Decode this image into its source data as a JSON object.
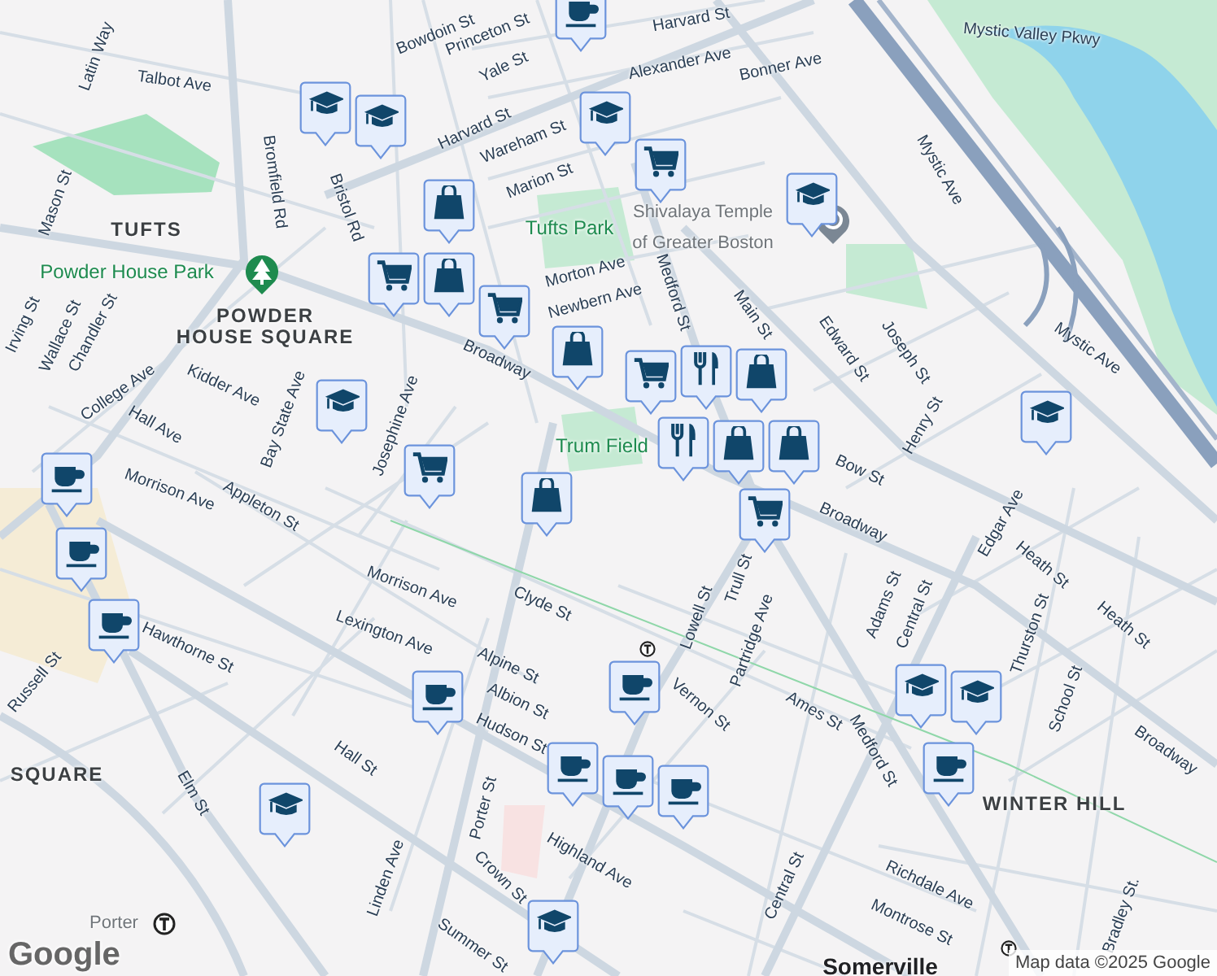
{
  "map": {
    "labels": [
      {
        "text": "Bowdoin St",
        "kind": "street"
      },
      {
        "text": "Princeton St",
        "kind": "street"
      },
      {
        "text": "Yale St",
        "kind": "street"
      },
      {
        "text": "Harvard St",
        "kind": "street"
      },
      {
        "text": "Harvard St",
        "kind": "street"
      },
      {
        "text": "Alexander Ave",
        "kind": "street"
      },
      {
        "text": "Bonner Ave",
        "kind": "street"
      },
      {
        "text": "Wareham St",
        "kind": "street"
      },
      {
        "text": "Marion St",
        "kind": "street"
      },
      {
        "text": "Talbot Ave",
        "kind": "street"
      },
      {
        "text": "Latin Way",
        "kind": "street"
      },
      {
        "text": "Mason St",
        "kind": "street"
      },
      {
        "text": "Bromfield Rd",
        "kind": "street"
      },
      {
        "text": "TUFTS",
        "kind": "district"
      },
      {
        "text": "Powder House Park",
        "kind": "park"
      },
      {
        "text": "POWDER",
        "kind": "district"
      },
      {
        "text": "HOUSE SQUARE",
        "kind": "district"
      },
      {
        "text": "Irving St",
        "kind": "street"
      },
      {
        "text": "Wallace St",
        "kind": "street"
      },
      {
        "text": "Chandler St",
        "kind": "street"
      },
      {
        "text": "College Ave",
        "kind": "street"
      },
      {
        "text": "Kidder Ave",
        "kind": "street"
      },
      {
        "text": "Hall Ave",
        "kind": "street"
      },
      {
        "text": "Bay State Ave",
        "kind": "street"
      },
      {
        "text": "Josephine Ave",
        "kind": "street"
      },
      {
        "text": "Bristol Rd",
        "kind": "street"
      },
      {
        "text": "Tufts Park",
        "kind": "park"
      },
      {
        "text": "Morton Ave",
        "kind": "street"
      },
      {
        "text": "Newbern Ave",
        "kind": "street"
      },
      {
        "text": "Broadway",
        "kind": "street"
      },
      {
        "text": "Medford St",
        "kind": "street"
      },
      {
        "text": "Mystic Valley Pkwy",
        "kind": "street"
      },
      {
        "text": "Mystic Ave",
        "kind": "street"
      },
      {
        "text": "Mystic Ave",
        "kind": "street"
      },
      {
        "text": "Shivalaya Temple",
        "kind": "poi"
      },
      {
        "text": "of Greater Boston",
        "kind": "poi"
      },
      {
        "text": "Main St",
        "kind": "street"
      },
      {
        "text": "Edward St",
        "kind": "street"
      },
      {
        "text": "Joseph St",
        "kind": "street"
      },
      {
        "text": "Henry St",
        "kind": "street"
      },
      {
        "text": "Bow St",
        "kind": "street"
      },
      {
        "text": "Broadway",
        "kind": "street"
      },
      {
        "text": "Trum Field",
        "kind": "park"
      },
      {
        "text": "Morrison Ave",
        "kind": "street"
      },
      {
        "text": "Appleton St",
        "kind": "street"
      },
      {
        "text": "Morrison Ave",
        "kind": "street"
      },
      {
        "text": "Clyde St",
        "kind": "street"
      },
      {
        "text": "Lexington Ave",
        "kind": "street"
      },
      {
        "text": "Alpine St",
        "kind": "street"
      },
      {
        "text": "Albion St",
        "kind": "street"
      },
      {
        "text": "Hudson St",
        "kind": "street"
      },
      {
        "text": "Hawthorne St",
        "kind": "street"
      },
      {
        "text": "Russell St",
        "kind": "street"
      },
      {
        "text": "SQUARE",
        "kind": "district"
      },
      {
        "text": "Elm St",
        "kind": "street"
      },
      {
        "text": "Hall St",
        "kind": "street"
      },
      {
        "text": "Porter St",
        "kind": "street"
      },
      {
        "text": "Crown St",
        "kind": "street"
      },
      {
        "text": "Linden Ave",
        "kind": "street"
      },
      {
        "text": "Highland Ave",
        "kind": "street"
      },
      {
        "text": "Summer St",
        "kind": "street"
      },
      {
        "text": "Porter",
        "kind": "poi"
      },
      {
        "text": "Lowell St",
        "kind": "street"
      },
      {
        "text": "Trull St",
        "kind": "street"
      },
      {
        "text": "Partridge Ave",
        "kind": "street"
      },
      {
        "text": "Vernon St",
        "kind": "street"
      },
      {
        "text": "Ames St",
        "kind": "street"
      },
      {
        "text": "Adams St",
        "kind": "street"
      },
      {
        "text": "Central St",
        "kind": "street"
      },
      {
        "text": "Medford St",
        "kind": "street"
      },
      {
        "text": "Thurston St",
        "kind": "street"
      },
      {
        "text": "School St",
        "kind": "street"
      },
      {
        "text": "WINTER HILL",
        "kind": "district"
      },
      {
        "text": "Heath St",
        "kind": "street"
      },
      {
        "text": "Heath St",
        "kind": "street"
      },
      {
        "text": "Edgar Ave",
        "kind": "street"
      },
      {
        "text": "Broadway",
        "kind": "street"
      },
      {
        "text": "Richdale Ave",
        "kind": "street"
      },
      {
        "text": "Montrose St",
        "kind": "street"
      },
      {
        "text": "Central St",
        "kind": "street"
      },
      {
        "text": "Bradley St.",
        "kind": "street"
      },
      {
        "text": "Somerville",
        "kind": "city"
      }
    ],
    "markers": [
      {
        "kind": "cafe"
      },
      {
        "kind": "school"
      },
      {
        "kind": "school"
      },
      {
        "kind": "school"
      },
      {
        "kind": "cart"
      },
      {
        "kind": "shop"
      },
      {
        "kind": "school"
      },
      {
        "kind": "cart"
      },
      {
        "kind": "shop"
      },
      {
        "kind": "cart"
      },
      {
        "kind": "shop"
      },
      {
        "kind": "cart"
      },
      {
        "kind": "restaurant"
      },
      {
        "kind": "restaurant"
      },
      {
        "kind": "shop"
      },
      {
        "kind": "shop"
      },
      {
        "kind": "shop"
      },
      {
        "kind": "cart"
      },
      {
        "kind": "school"
      },
      {
        "kind": "cart"
      },
      {
        "kind": "shop"
      },
      {
        "kind": "school"
      },
      {
        "kind": "cafe"
      },
      {
        "kind": "cafe"
      },
      {
        "kind": "cafe"
      },
      {
        "kind": "cafe"
      },
      {
        "kind": "cafe"
      },
      {
        "kind": "cafe"
      },
      {
        "kind": "cafe"
      },
      {
        "kind": "cafe"
      },
      {
        "kind": "school"
      },
      {
        "kind": "school"
      },
      {
        "kind": "school"
      },
      {
        "kind": "school"
      },
      {
        "kind": "cafe"
      }
    ],
    "logo": "Google",
    "attribution": "Map data ©2025 Google"
  }
}
